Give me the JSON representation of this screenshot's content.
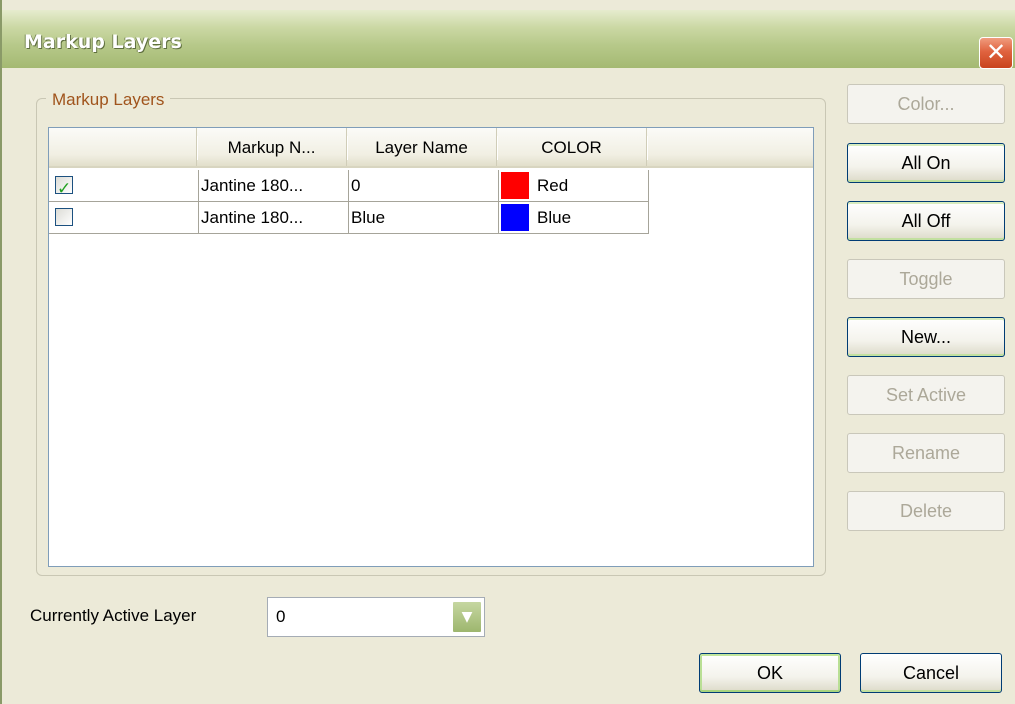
{
  "window": {
    "title": "Markup Layers",
    "close_glyph": "✕"
  },
  "group": {
    "legend": "Markup Layers"
  },
  "table": {
    "columns": [
      "",
      "Markup N...",
      "Layer Name",
      "COLOR"
    ],
    "rows": [
      {
        "checked": true,
        "markup": "Jantine 180...",
        "layer": "0",
        "color_hex": "#ff0000",
        "color_name": "Red"
      },
      {
        "checked": false,
        "markup": "Jantine 180...",
        "layer": "Blue",
        "color_hex": "#0000ff",
        "color_name": "Blue"
      }
    ]
  },
  "buttons": {
    "color": "Color...",
    "all_on": "All On",
    "all_off": "All Off",
    "toggle": "Toggle",
    "new": "New...",
    "set_active": "Set Active",
    "rename": "Rename",
    "delete": "Delete",
    "ok": "OK",
    "cancel": "Cancel"
  },
  "active_layer": {
    "label": "Currently Active Layer",
    "value": "0"
  },
  "icons": {
    "close": "close-icon",
    "check": "checkmark-icon",
    "dropdown": "chevron-down-icon"
  }
}
